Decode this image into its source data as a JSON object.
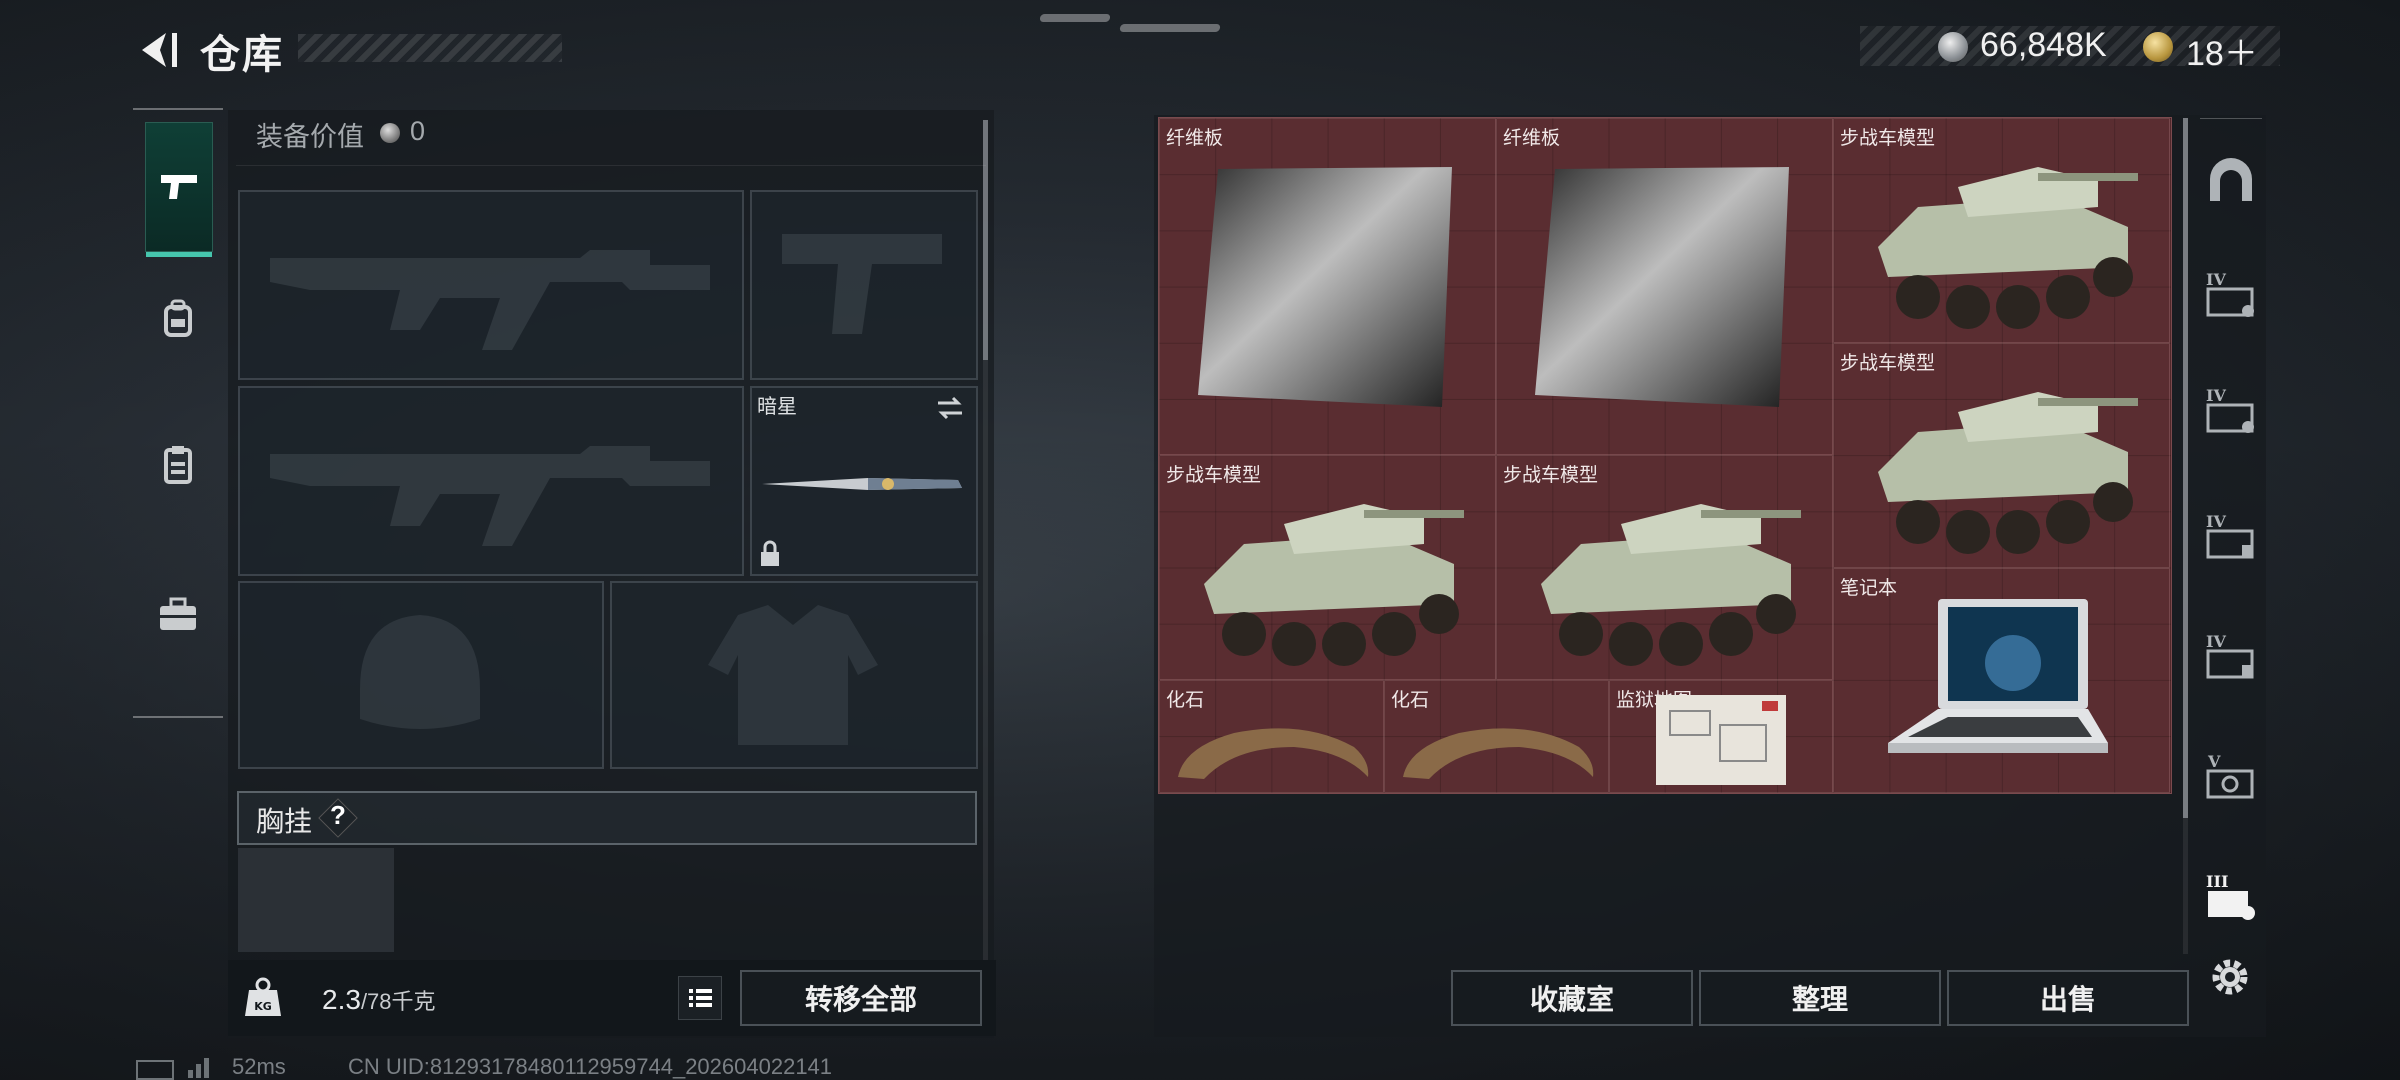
{
  "header": {
    "title": "仓库",
    "currency_silver": "66,848K",
    "currency_gold": "18＋"
  },
  "left_tabs": [
    {
      "icon": "pistol-icon",
      "active": true
    },
    {
      "icon": "backpack-icon",
      "active": false
    },
    {
      "icon": "clipboard-icon",
      "active": false
    },
    {
      "icon": "toolbox-icon",
      "active": false
    }
  ],
  "equipment": {
    "value_label": "装备价值",
    "value": "0",
    "melee_name": "暗星",
    "chest_rig_label": "胸挂",
    "chest_rig_help": "?"
  },
  "bottom_left": {
    "weight": "2.3",
    "weight_max": "/78千克",
    "transfer_all": "转移全部"
  },
  "status": {
    "ping": "52ms",
    "uid": "CN UID:81293178480112959744_202604022141"
  },
  "storage_items": [
    {
      "name": "纤维板",
      "kind": "fiberboard"
    },
    {
      "name": "纤维板",
      "kind": "fiberboard"
    },
    {
      "name": "步战车模型",
      "kind": "ifv"
    },
    {
      "name": "步战车模型",
      "kind": "ifv"
    },
    {
      "name": "步战车模型",
      "kind": "ifv"
    },
    {
      "name": "步战车模型",
      "kind": "ifv"
    },
    {
      "name": "笔记本",
      "kind": "laptop"
    },
    {
      "name": "化石",
      "kind": "fossil"
    },
    {
      "name": "化石",
      "kind": "fossil"
    },
    {
      "name": "监狱地图",
      "kind": "map"
    }
  ],
  "right_tabs": [
    {
      "icon": "vault-arch-icon"
    },
    {
      "icon": "case-level-iv-icon",
      "label": "IV"
    },
    {
      "icon": "case-level-iv-icon",
      "label": "IV"
    },
    {
      "icon": "case-level-iv-icon",
      "label": "IV"
    },
    {
      "icon": "case-level-iv-icon",
      "label": "IV"
    },
    {
      "icon": "case-level-v-icon",
      "label": "V"
    },
    {
      "icon": "case-level-iii-icon",
      "label": "III"
    }
  ],
  "bottom_right": {
    "collection": "收藏室",
    "sort": "整理",
    "sell": "出售"
  },
  "colors": {
    "accent": "#46c6ad",
    "storage_bg": "#5a2d31"
  }
}
